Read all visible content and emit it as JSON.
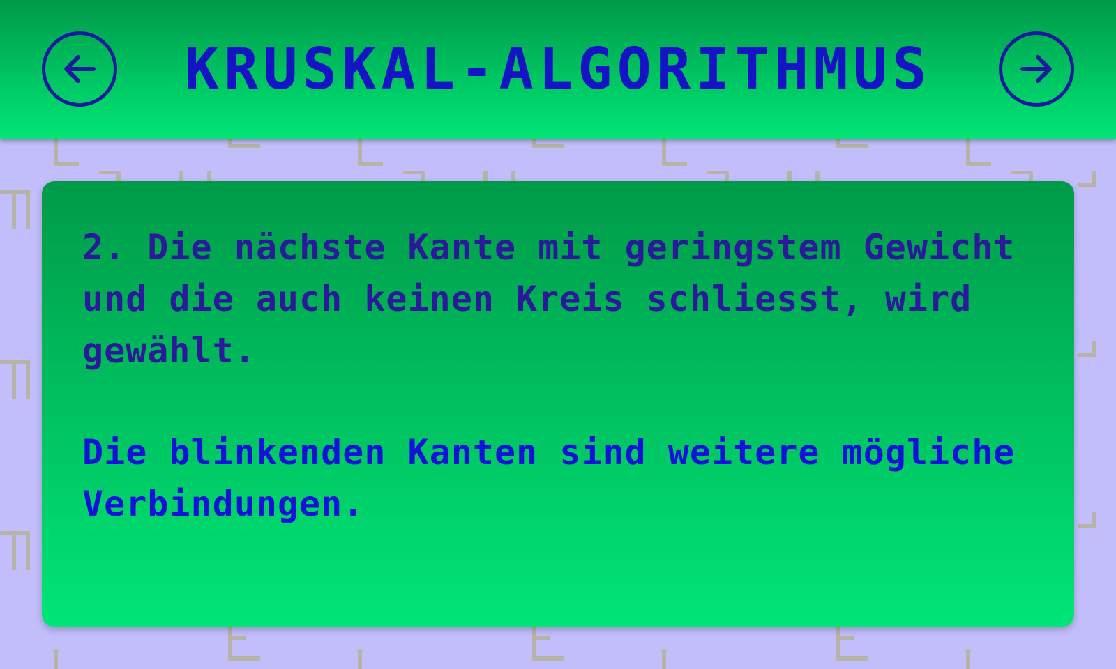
{
  "header": {
    "title": "KRUSKAL-ALGORITHMUS",
    "back_icon": "arrow-left-circle-icon",
    "forward_icon": "arrow-right-circle-icon"
  },
  "card": {
    "step_text": "2. Die nächste Kante mit geringstem Gewicht und die auch keinen Kreis schliesst, wird gewählt.",
    "hint_text": "Die blinkenden Kanten sind weitere mögliche Verbindungen."
  },
  "colors": {
    "background": "#c2bdfb",
    "gradient_top": "#009a49",
    "gradient_bottom": "#00e676",
    "title_text": "#1414c4",
    "step_text": "#2a1a9a",
    "hint_text": "#1212d8",
    "icon_stroke": "#1a1a9c",
    "pattern": "#b8b3a8"
  },
  "background_pattern": "circuit-line-pattern"
}
